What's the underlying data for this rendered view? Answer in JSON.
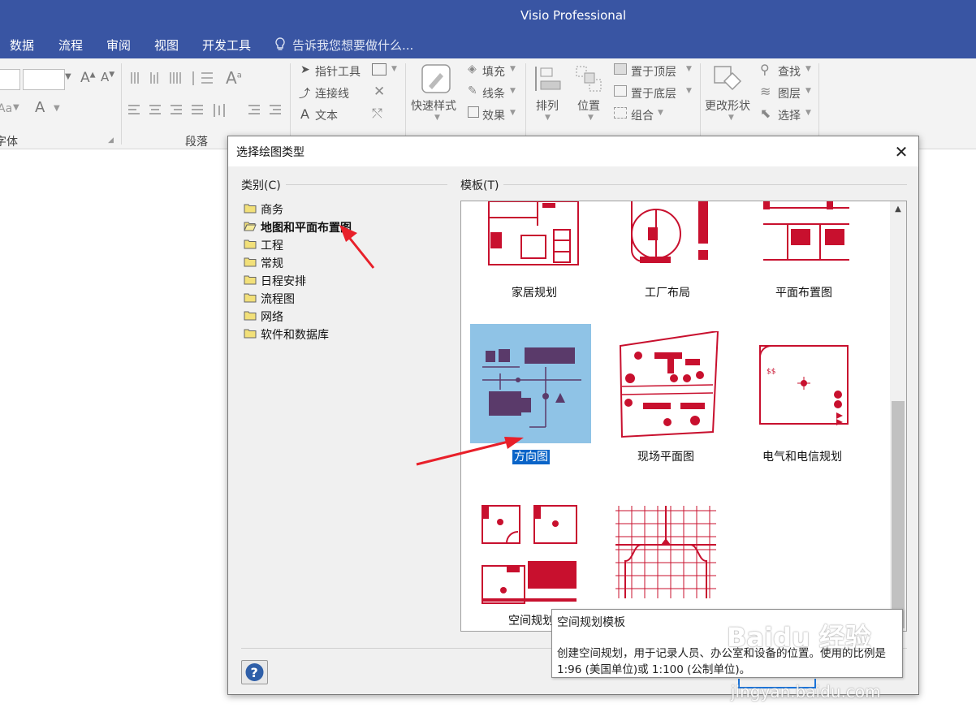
{
  "app": {
    "title": "Visio Professional"
  },
  "menu": {
    "items": [
      "数据",
      "流程",
      "审阅",
      "视图",
      "开发工具"
    ],
    "tell_me": "告诉我您想要做什么..."
  },
  "ribbon": {
    "group_labels": {
      "font": "字体",
      "paragraph": "段落"
    },
    "tools": {
      "pointer": "指针工具",
      "connector": "连接线",
      "text": "文本"
    },
    "shape_styles": {
      "quick_styles": "快速样式",
      "fill": "填充",
      "line": "线条",
      "effects": "效果"
    },
    "arrange": {
      "arrange": "排列",
      "position": "位置",
      "bring_front": "置于顶层",
      "send_back": "置于底层",
      "group": "组合"
    },
    "editing": {
      "change_shape": "更改形状",
      "find": "查找",
      "layers": "图层",
      "select": "选择"
    },
    "font_sample": "Aa"
  },
  "dialog": {
    "title": "选择绘图类型",
    "category_label": "类别(C)",
    "template_label": "模板(T)",
    "categories": [
      {
        "label": "商务",
        "selected": false
      },
      {
        "label": "地图和平面布置图",
        "selected": true
      },
      {
        "label": "工程",
        "selected": false
      },
      {
        "label": "常规",
        "selected": false
      },
      {
        "label": "日程安排",
        "selected": false
      },
      {
        "label": "流程图",
        "selected": false
      },
      {
        "label": "网络",
        "selected": false
      },
      {
        "label": "软件和数据库",
        "selected": false
      }
    ],
    "templates": [
      {
        "label": "家居规划"
      },
      {
        "label": "工厂布局"
      },
      {
        "label": "平面布置图"
      },
      {
        "label": "方向图",
        "selected": true
      },
      {
        "label": "现场平面图"
      },
      {
        "label": "电气和电信规划"
      },
      {
        "label": "空间规划"
      }
    ]
  },
  "tooltip": {
    "title": "空间规划模板",
    "description": "创建空间规划，用于记录人员、办公室和设备的位置。使用的比例是 1:96 (美国单位)或 1:100 (公制单位)。"
  },
  "colors": {
    "titlebar": "#3955a3",
    "template_red": "#c8102e",
    "selection": "#0a64c8",
    "annotation_arrow": "#e8202a"
  },
  "watermark": {
    "brand": "Baidu 经验",
    "url": "jingyan.baidu.com"
  }
}
